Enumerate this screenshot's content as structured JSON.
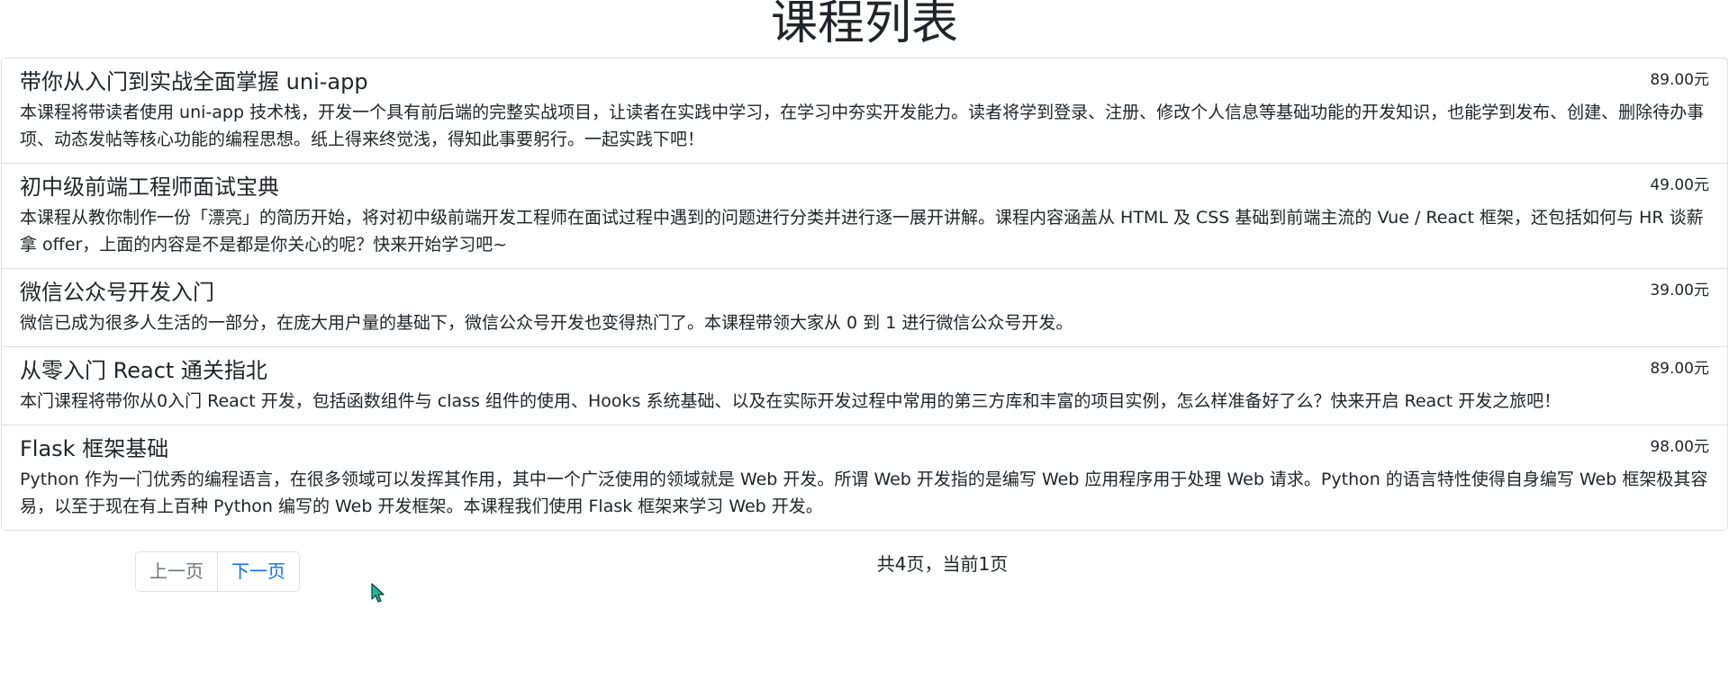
{
  "page": {
    "title": "课程列表"
  },
  "courses": [
    {
      "title": "带你从入门到实战全面掌握 uni-app",
      "price": "89.00元",
      "description": "本课程将带读者使用 uni-app 技术栈，开发一个具有前后端的完整实战项目，让读者在实践中学习，在学习中夯实开发能力。读者将学到登录、注册、修改个人信息等基础功能的开发知识，也能学到发布、创建、删除待办事项、动态发帖等核心功能的编程思想。纸上得来终觉浅，得知此事要躬行。一起实践下吧！"
    },
    {
      "title": "初中级前端工程师面试宝典",
      "price": "49.00元",
      "description": "本课程从教你制作一份「漂亮」的简历开始，将对初中级前端开发工程师在面试过程中遇到的问题进行分类并进行逐一展开讲解。课程内容涵盖从 HTML 及 CSS 基础到前端主流的 Vue / React 框架，还包括如何与 HR 谈薪拿 offer，上面的内容是不是都是你关心的呢？快来开始学习吧~"
    },
    {
      "title": "微信公众号开发入门",
      "price": "39.00元",
      "description": "微信已成为很多人生活的一部分，在庞大用户量的基础下，微信公众号开发也变得热门了。本课程带领大家从 0 到 1 进行微信公众号开发。"
    },
    {
      "title": "从零入门 React 通关指北",
      "price": "89.00元",
      "description": "本门课程将带你从0入门 React 开发，包括函数组件与 class 组件的使用、Hooks 系统基础、以及在实际开发过程中常用的第三方库和丰富的项目实例，怎么样准备好了么？快来开启 React 开发之旅吧！"
    },
    {
      "title": "Flask 框架基础",
      "price": "98.00元",
      "description": "Python 作为一门优秀的编程语言，在很多领域可以发挥其作用，其中一个广泛使用的领域就是 Web 开发。所谓 Web 开发指的是编写 Web 应用程序用于处理 Web 请求。Python 的语言特性使得自身编写 Web 框架极其容易，以至于现在有上百种 Python 编写的 Web 开发框架。本课程我们使用 Flask 框架来学习 Web 开发。"
    }
  ],
  "pagination": {
    "prev_label": "上一页",
    "next_label": "下一页",
    "info": "共4页，当前1页"
  },
  "colors": {
    "link": "#0d6efd",
    "disabled": "#6c757d",
    "border": "#dee2e6",
    "cursor_fill": "#1fb89a"
  },
  "icons": {
    "cursor": "mouse-pointer-icon"
  }
}
